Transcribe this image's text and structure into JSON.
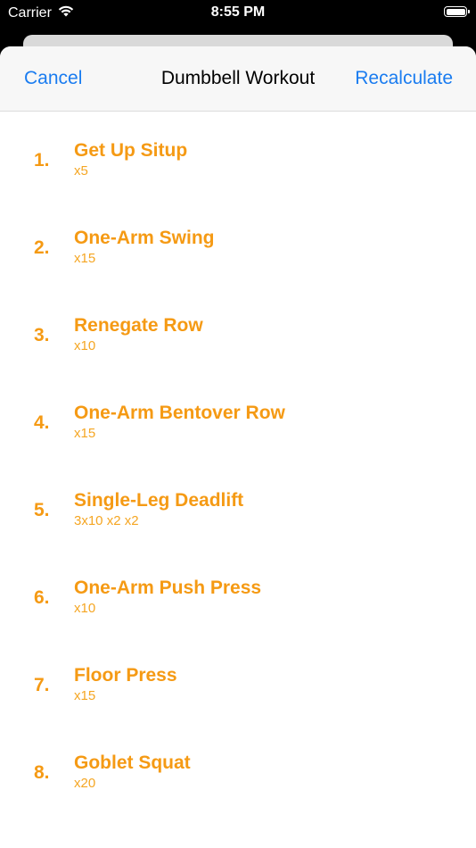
{
  "status_bar": {
    "carrier": "Carrier",
    "time": "8:55 PM",
    "wifi_icon": "wifi-icon",
    "battery_icon": "battery-icon"
  },
  "nav": {
    "cancel_label": "Cancel",
    "title": "Dumbbell Workout",
    "recalculate_label": "Recalculate"
  },
  "colors": {
    "accent": "#1a7cf0",
    "exercise_orange": "#f59a14"
  },
  "exercises": [
    {
      "number": "1.",
      "name": "Get Up Situp",
      "reps": "x5"
    },
    {
      "number": "2.",
      "name": "One-Arm Swing",
      "reps": "x15"
    },
    {
      "number": "3.",
      "name": "Renegate Row",
      "reps": "x10"
    },
    {
      "number": "4.",
      "name": "One-Arm Bentover Row",
      "reps": "x15"
    },
    {
      "number": "5.",
      "name": "Single-Leg Deadlift",
      "reps": "3x10 x2 x2"
    },
    {
      "number": "6.",
      "name": "One-Arm Push Press",
      "reps": "x10"
    },
    {
      "number": "7.",
      "name": "Floor Press",
      "reps": "x15"
    },
    {
      "number": "8.",
      "name": "Goblet Squat",
      "reps": "x20"
    }
  ]
}
